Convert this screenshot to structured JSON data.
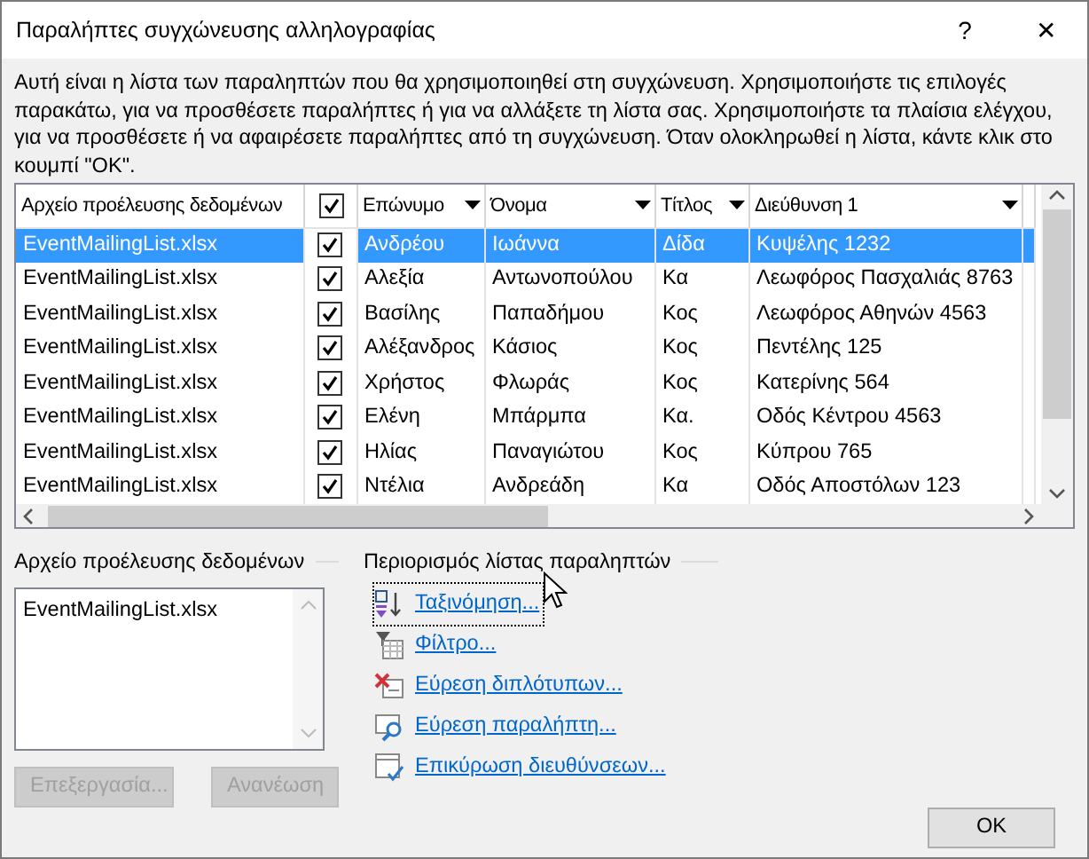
{
  "window": {
    "title": "Παραλήπτες συγχώνευσης αλληλογραφίας",
    "help": "?",
    "close": "✕"
  },
  "description": "Αυτή είναι η λίστα των παραληπτών που θα χρησιμοποιηθεί στη συγχώνευση. Χρησιμοποιήστε τις επιλογές παρακάτω, για να προσθέσετε παραλήπτες ή για να αλλάξετε τη λίστα σας. Χρησιμοποιήστε τα πλαίσια ελέγχου, για να προσθέσετε ή να αφαιρέσετε παραλήπτες από τη συγχώνευση. Όταν ολοκληρωθεί η λίστα, κάντε κλικ στο κουμπί \"ΟΚ\".",
  "table": {
    "columns": [
      {
        "label": "Αρχείο προέλευσης δεδομένων",
        "kind": "text"
      },
      {
        "kind": "check",
        "checked": true
      },
      {
        "label": "Επώνυμο",
        "kind": "dropdown"
      },
      {
        "label": "Όνομα",
        "kind": "dropdown"
      },
      {
        "label": "Τίτλος",
        "kind": "dropdown"
      },
      {
        "label": "Διεύθυνση 1",
        "kind": "dropdown"
      }
    ],
    "rows": [
      {
        "source": "EventMailingList.xlsx",
        "checked": true,
        "surname": "Ανδρέου",
        "name": "Ιωάννα",
        "title": "Δίδα",
        "address": "Κυψέλης 1232",
        "selected": true
      },
      {
        "source": "EventMailingList.xlsx",
        "checked": true,
        "surname": "Αλεξία",
        "name": "Αντωνοπούλου",
        "title": "Κα",
        "address": "Λεωφόρος Πασχαλιάς 8763",
        "selected": false
      },
      {
        "source": "EventMailingList.xlsx",
        "checked": true,
        "surname": "Βασίλης",
        "name": "Παπαδήμου",
        "title": "Κος",
        "address": "Λεωφόρος Αθηνών 4563",
        "selected": false
      },
      {
        "source": "EventMailingList.xlsx",
        "checked": true,
        "surname": "Αλέξανδρος",
        "name": "Κάσιος",
        "title": "Κος",
        "address": "Πεντέλης 125",
        "selected": false
      },
      {
        "source": "EventMailingList.xlsx",
        "checked": true,
        "surname": "Χρήστος",
        "name": "Φλωράς",
        "title": "Κος",
        "address": "Κατερίνης 564",
        "selected": false
      },
      {
        "source": "EventMailingList.xlsx",
        "checked": true,
        "surname": "Ελένη",
        "name": "Μπάρμπα",
        "title": "Κα.",
        "address": "Οδός Κέντρου 4563",
        "selected": false
      },
      {
        "source": "EventMailingList.xlsx",
        "checked": true,
        "surname": "Ηλίας",
        "name": "Παναγιώτου",
        "title": "Κος",
        "address": "Κύπρου 765",
        "selected": false
      },
      {
        "source": "EventMailingList.xlsx",
        "checked": true,
        "surname": "Ντέλια",
        "name": "Ανδρεάδη",
        "title": "Κα",
        "address": "Οδός Αποστόλων 123",
        "selected": false
      }
    ]
  },
  "data_sources": {
    "heading": "Αρχείο προέλευσης δεδομένων",
    "items": [
      "EventMailingList.xlsx"
    ],
    "buttons": [
      {
        "label": "Επεξεργασία...",
        "disabled": true
      },
      {
        "label": "Ανανέωση",
        "disabled": true
      }
    ]
  },
  "refine": {
    "heading": "Περιορισμός λίστας παραληπτών",
    "links": [
      {
        "label": "Ταξινόμηση...",
        "kind": "sort",
        "focused": true
      },
      {
        "label": "Φίλτρο...",
        "kind": "filter",
        "focused": false
      },
      {
        "label": "Εύρεση διπλότυπων...",
        "kind": "duplicates",
        "focused": false
      },
      {
        "label": "Εύρεση παραλήπτη...",
        "kind": "find",
        "focused": false
      },
      {
        "label": "Επικύρωση διευθύνσεων...",
        "kind": "validate",
        "focused": false
      }
    ]
  },
  "ok_button": "OK"
}
